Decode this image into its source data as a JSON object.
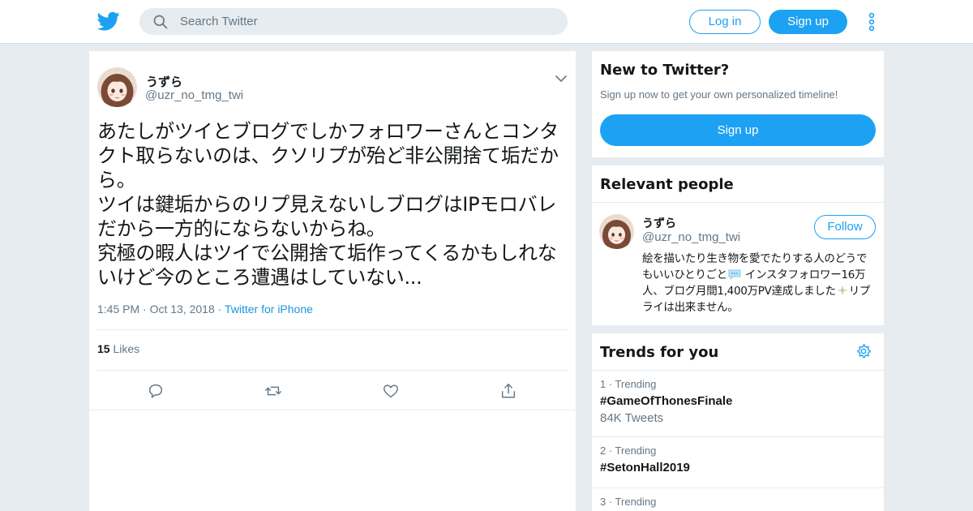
{
  "header": {
    "search_placeholder": "Search Twitter",
    "login_label": "Log in",
    "signup_label": "Sign up",
    "brand_color": "#1da1f2"
  },
  "tweet": {
    "name": "うずら",
    "handle": "@uzr_no_tmg_twi",
    "text": "あたしがツイとブログでしかフォロワーさんとコンタクト取らないのは、クソリプが殆ど非公開捨て垢だから。\nツイは鍵垢からのリプ見えないしブログはIPモロバレだから一方的にならないからね。\n究極の暇人はツイで公開捨て垢作ってくるかもしれないけど今のところ遭遇はしていない...",
    "time": "1:45 PM",
    "date": "Oct 13, 2018",
    "source": "Twitter for iPhone",
    "likes_count": "15",
    "likes_label": "Likes"
  },
  "new_to_twitter": {
    "title": "New to Twitter?",
    "subtitle": "Sign up now to get your own personalized timeline!",
    "signup_label": "Sign up"
  },
  "relevant_people": {
    "title": "Relevant people",
    "name": "うずら",
    "handle": "@uzr_no_tmg_twi",
    "follow_label": "Follow",
    "bio_part1": "絵を描いたり生き物を愛でたりする人のどうでもいいひとりごと",
    "bio_part2": " インスタフォロワー16万人、ブログ月間1,400万PV達成しました",
    "bio_part3": "リプライは出来ません。"
  },
  "trends": {
    "title": "Trends for you",
    "items": [
      {
        "rank": "1 · Trending",
        "tag": "#GameOfThonesFinale",
        "count": "84K Tweets"
      },
      {
        "rank": "2 · Trending",
        "tag": "#SetonHall2019",
        "count": ""
      },
      {
        "rank": "3 · Trending",
        "tag": "",
        "count": ""
      }
    ]
  },
  "icons": [
    "twitter-bird-icon",
    "search-icon",
    "more-vertical-icon",
    "chevron-down-icon",
    "reply-icon",
    "retweet-icon",
    "heart-icon",
    "share-icon",
    "gear-icon",
    "speech-bubble-emoji",
    "sparkle-emoji"
  ]
}
